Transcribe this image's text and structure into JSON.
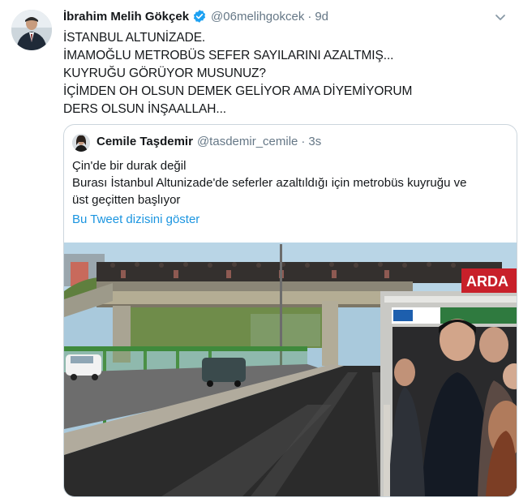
{
  "tweet": {
    "author_name": "İbrahim Melih Gökçek",
    "author_handle": "@06melihgokcek",
    "separator": "·",
    "time": "9d",
    "lines": [
      "İSTANBUL ALTUNİZADE.",
      "İMAMOĞLU METROBÜS SEFER SAYILARINI AZALTMIŞ...",
      "KUYRUĞU GÖRÜYOR MUSUNUZ?",
      "İÇİMDEN OH OLSUN DEMEK GELİYOR AMA DİYEMİYORUM",
      "DERS OLSUN İNŞAALLAH..."
    ]
  },
  "quoted_tweet": {
    "author_name": "Cemile Taşdemir",
    "author_handle": "@tasdemir_cemile",
    "separator": "·",
    "time": "3s",
    "lines": [
      "Çin'de bir durak değil",
      "Burası İstanbul Altunizade'de seferler azaltıldığı için metrobüs kuyruğu ve",
      "üst geçitten başlıyor"
    ],
    "thread_link": "Bu Tweet dizisini göster",
    "photo_sign_text": "ARDA"
  },
  "icons": {
    "verified": "verified-badge-icon",
    "caret": "chevron-down-icon"
  },
  "colors": {
    "text": "#14171a",
    "secondary": "#657786",
    "link": "#1b95e0",
    "verified": "#1da1f2",
    "border": "#ccd6dd",
    "sign_red": "#c8202a"
  }
}
